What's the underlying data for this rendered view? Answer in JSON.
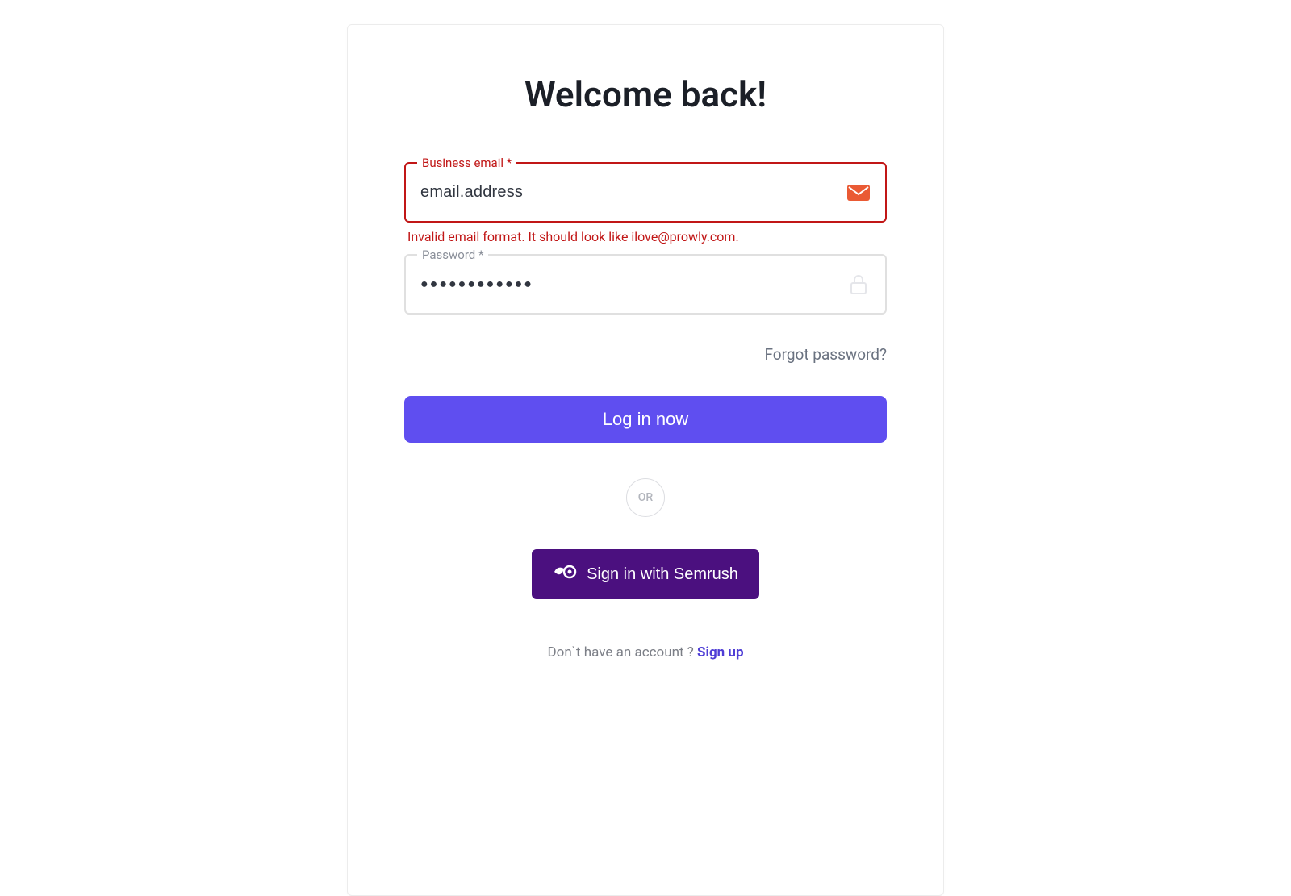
{
  "title": "Welcome back!",
  "form": {
    "email": {
      "label": "Business email *",
      "value": "email.address",
      "error": "Invalid email format. It should look like ilove@prowly.com."
    },
    "password": {
      "label": "Password *",
      "value": "●●●●●●●●●●●●"
    },
    "forgot_label": "Forgot password?",
    "login_label": "Log in now",
    "separator_label": "OR",
    "semrush_label": "Sign in with Semrush",
    "signup_prompt": "Don`t have an account ? ",
    "signup_label": "Sign up"
  },
  "colors": {
    "primary": "#5f4ef0",
    "error": "#c11616",
    "semrush": "#4b107f",
    "accent_icon": "#ea5a34"
  }
}
